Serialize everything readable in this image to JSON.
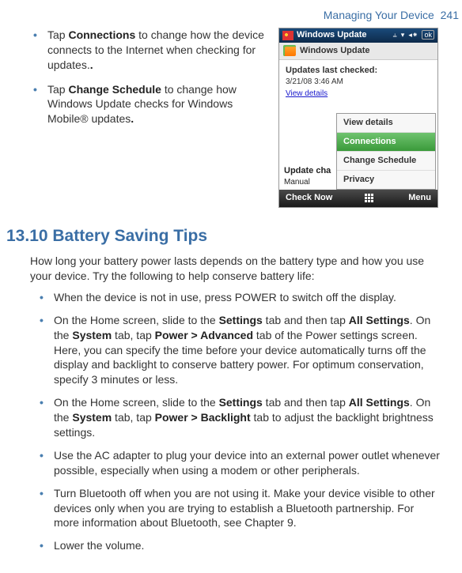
{
  "header": {
    "section_title": "Managing Your Device",
    "page_num": "241"
  },
  "top_bullets": [
    {
      "pre": "Tap ",
      "b": "Connections",
      "post": " to change how the device connects to the Internet when checking for updates."
    },
    {
      "pre": "Tap ",
      "b": "Change Schedule",
      "post": " to change how Windows Update checks for Windows Mobile® updates"
    }
  ],
  "phone": {
    "top_title": "Windows Update",
    "top_ok": "ok",
    "band_title": "Windows Update",
    "updates_label": "Updates last checked:",
    "updates_time": "3/21/08  3:46 AM",
    "view_details_link": "View details",
    "left_peek_main": "Update cha",
    "left_peek_sub": "Manual",
    "menu": {
      "items": [
        "View details",
        "Connections",
        "Change Schedule",
        "Privacy"
      ],
      "selected": "Connections"
    },
    "bottom_left": "Check Now",
    "bottom_right": "Menu"
  },
  "section_heading": "13.10  Battery Saving Tips",
  "intro": "How long your battery power lasts depends on the battery type and how you use your device. Try the following to help conserve battery life:",
  "tips": [
    {
      "runs": [
        {
          "t": "When the device is not in use, press POWER to switch off the display."
        }
      ]
    },
    {
      "runs": [
        {
          "t": "On the Home screen, slide to the "
        },
        {
          "t": "Settings",
          "b": true
        },
        {
          "t": " tab and then tap "
        },
        {
          "t": "All Settings",
          "b": true
        },
        {
          "t": ". On the "
        },
        {
          "t": "System",
          "b": true
        },
        {
          "t": " tab, tap "
        },
        {
          "t": "Power > Advanced",
          "b": true
        },
        {
          "t": " tab of the Power settings screen. Here, you can specify the time before your device automatically turns off the display and backlight to conserve battery power. For optimum conservation, specify 3 minutes or less."
        }
      ]
    },
    {
      "runs": [
        {
          "t": "On the Home screen, slide to the "
        },
        {
          "t": "Settings",
          "b": true
        },
        {
          "t": " tab and then tap "
        },
        {
          "t": "All Settings",
          "b": true
        },
        {
          "t": ". On the "
        },
        {
          "t": "System",
          "b": true
        },
        {
          "t": " tab, tap "
        },
        {
          "t": "Power > Backlight",
          "b": true
        },
        {
          "t": " tab to adjust the backlight brightness settings."
        }
      ]
    },
    {
      "runs": [
        {
          "t": "Use the AC adapter to plug your device into an external power outlet whenever possible, especially when using a modem or other peripherals."
        }
      ]
    },
    {
      "runs": [
        {
          "t": "Turn Bluetooth off when you are not using it. Make your device visible to other devices only when you are trying to establish a Bluetooth partnership. For more information about Bluetooth, see Chapter 9."
        }
      ]
    },
    {
      "runs": [
        {
          "t": "Lower the volume."
        }
      ]
    }
  ]
}
